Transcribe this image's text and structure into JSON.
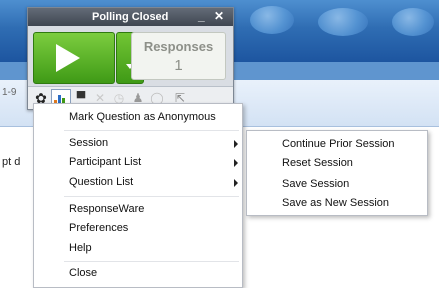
{
  "widget": {
    "title": "Polling Closed",
    "minimize_glyph": "_",
    "close_glyph": "✕",
    "responses_label": "Responses",
    "responses_count": "1"
  },
  "background": {
    "cut_text": "pt d",
    "left_snip": "1-9"
  },
  "toolbar": {
    "icons": [
      "gear-icon",
      "chart-icon",
      "presenter-icon",
      "x-icon",
      "clock-icon",
      "team-icon",
      "speech-bubble-icon",
      "popout-icon"
    ]
  },
  "menu": {
    "items": [
      {
        "label": "Mark Question as Anonymous",
        "submenu": false
      },
      {
        "label": "Session",
        "submenu": true
      },
      {
        "label": "Participant List",
        "submenu": true
      },
      {
        "label": "Question List",
        "submenu": true
      },
      {
        "label": "ResponseWare",
        "submenu": false
      },
      {
        "label": "Preferences",
        "submenu": false
      },
      {
        "label": "Help",
        "submenu": false
      },
      {
        "label": "Close",
        "submenu": false
      }
    ]
  },
  "session_submenu": {
    "items": [
      {
        "label": "Continue Prior Session"
      },
      {
        "label": "Reset Session"
      },
      {
        "label": "Save Session"
      },
      {
        "label": "Save as New Session"
      }
    ]
  },
  "colors": {
    "accent_green": "#3f9a16",
    "title_bar": "#3f4651",
    "background_blue": "#2f6db3"
  }
}
